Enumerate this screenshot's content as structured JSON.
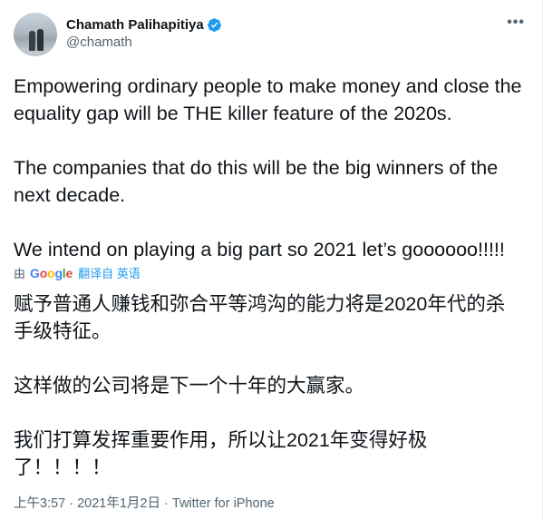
{
  "author": {
    "display_name": "Chamath Palihapitiya",
    "handle": "@chamath",
    "verified": true
  },
  "colors": {
    "text": "#0f1419",
    "secondary": "#536471",
    "accent": "#1d9bf0"
  },
  "icons": [
    "avatar-photo",
    "verified-badge-icon",
    "more-options-icon",
    "google-logo"
  ],
  "tweet": {
    "paragraphs": [
      "Empowering ordinary people to make money and close the equality gap will be THE killer feature of the 2020s.",
      "The companies that do this will be the big winners of the next decade.",
      "We intend on playing a big part so 2021 let’s goooooo!!!!!"
    ]
  },
  "translation": {
    "by_label": "由",
    "provider": "Google",
    "translate_label": "翻译自 英语",
    "paragraphs": [
      "赋予普通人赚钱和弥合平等鸿沟的能力将是2020年代的杀手级特征。",
      "这样做的公司将是下一个十年的大赢家。",
      "我们打算发挥重要作用，所以让2021年变得好极了！！！！"
    ]
  },
  "footer": {
    "timestamp": "上午3:57 · 2021年1月2日",
    "separator": " · ",
    "source": "Twitter for iPhone"
  }
}
